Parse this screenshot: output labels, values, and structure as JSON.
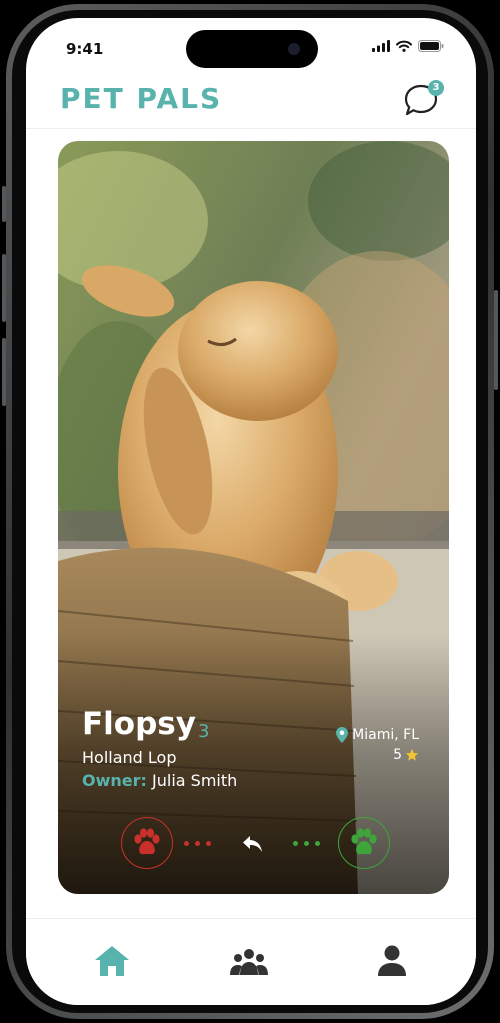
{
  "status_bar": {
    "time": "9:41"
  },
  "header": {
    "logo": "PET PALS",
    "chat_badge": "3"
  },
  "card": {
    "name": "Flopsy",
    "age": "3",
    "breed": "Holland Lop",
    "owner_label": "Owner:",
    "owner_name": "Julia Smith",
    "location": "Miami, FL",
    "rating": "5"
  },
  "colors": {
    "accent": "#58b3ad",
    "pass": "#c9302c",
    "like": "#3ea53a"
  },
  "icons": {
    "chat": "chat-bubble-icon",
    "location": "map-pin-icon",
    "rating": "star-icon",
    "pass": "paw-icon",
    "undo": "undo-arrow-icon",
    "like": "paw-icon",
    "tabs": [
      "home-icon",
      "group-icon",
      "person-icon"
    ]
  }
}
